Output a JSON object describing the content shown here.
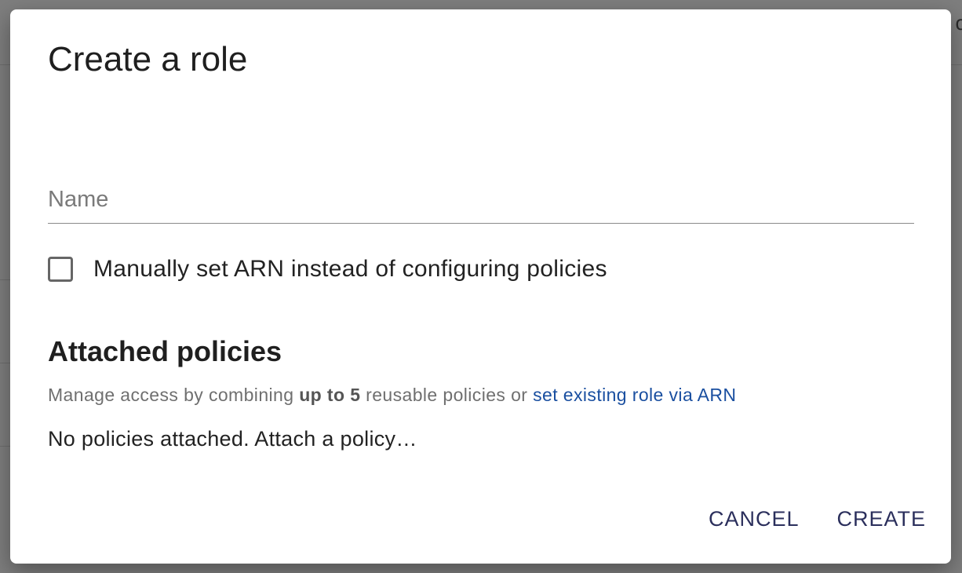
{
  "dialog": {
    "title": "Create a role",
    "name_field": {
      "placeholder": "Name",
      "value": ""
    },
    "manual_arn_checkbox": {
      "label": "Manually set ARN instead of configuring policies",
      "checked": false
    },
    "attached_policies": {
      "heading": "Attached policies",
      "help_prefix": "Manage access by combining ",
      "help_bold": "up to 5",
      "help_middle": " reusable policies or ",
      "help_link": "set existing role via ARN",
      "empty_message": "No policies attached. Attach a policy…"
    },
    "actions": {
      "cancel_label": "CANCEL",
      "create_label": "CREATE"
    }
  },
  "background": {
    "partial_text": "o"
  },
  "colors": {
    "link": "#1a4fa0",
    "action_button": "#2b2f5c",
    "backdrop": "#7e7e7e"
  }
}
